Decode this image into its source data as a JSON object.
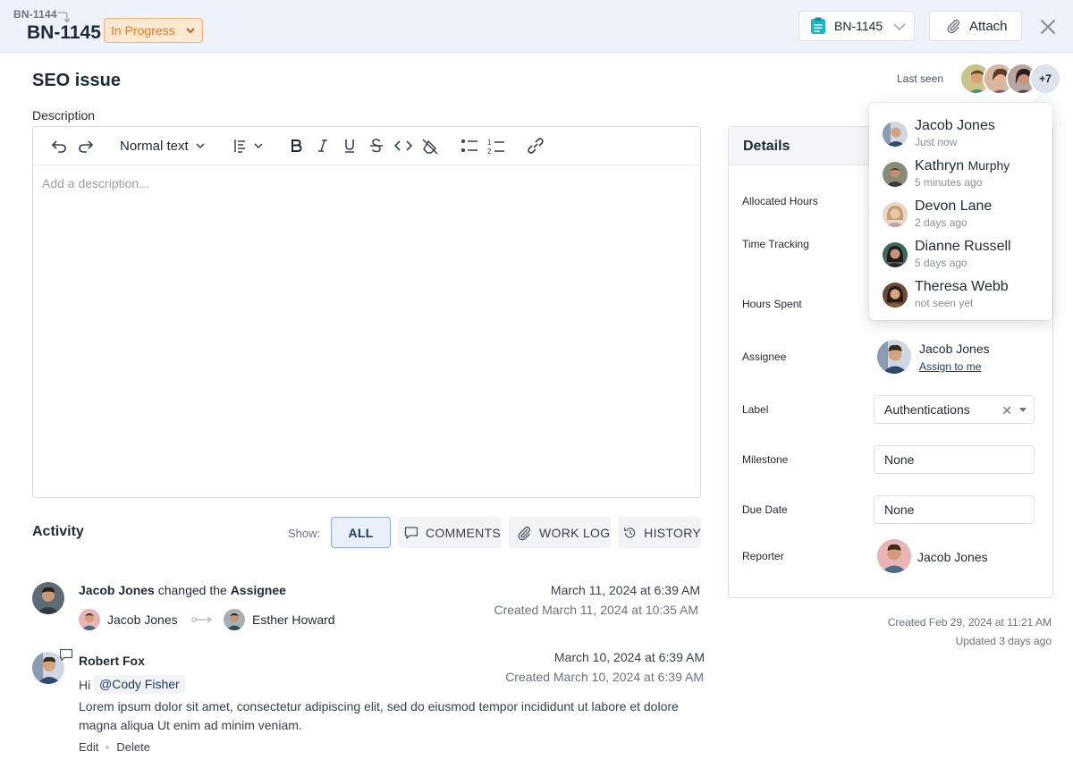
{
  "header": {
    "parent_key": "BN-1144",
    "issue_key": "BN-1145",
    "status": "In Progress",
    "key_button": "BN-1145",
    "attach_label": "Attach"
  },
  "issue": {
    "title": "SEO issue",
    "last_seen_label": "Last seen",
    "viewers_more": "+7"
  },
  "description": {
    "label": "Description",
    "text_style": "Normal text",
    "placeholder": "Add a description..."
  },
  "activity": {
    "title": "Activity",
    "show_label": "Show:",
    "filters": [
      "ALL",
      "COMMENTS",
      "WORK LOG",
      "HISTORY"
    ],
    "entries": [
      {
        "actor": "Jacob Jones",
        "action": " changed the ",
        "field": "Assignee",
        "date": "March 11, 2024 at 6:39 AM",
        "created": "Created March 11, 2024 at 10:35 AM",
        "from": "Jacob Jones",
        "to": "Esther Howard"
      },
      {
        "actor": "Robert Fox",
        "date": "March 10, 2024 at 6:39 AM",
        "created": "Created March 10, 2024 at 6:39 AM",
        "greeting": "Hi",
        "mention": "@Cody Fisher",
        "body": "Lorem ipsum dolor sit amet, consectetur adipiscing elit, sed do eiusmod tempor incididunt ut labore et dolore magna aliqua Ut enim ad minim veniam.",
        "edit_label": "Edit",
        "delete_label": "Delete"
      }
    ]
  },
  "details": {
    "title": "Details",
    "fields": {
      "allocated_hours": "Allocated Hours",
      "time_tracking": "Time Tracking",
      "hours_spent": "Hours Spent",
      "assignee": "Assignee",
      "label": "Label",
      "milestone": "Milestone",
      "due_date": "Due Date",
      "reporter": "Reporter"
    },
    "assignee_name": "Jacob Jones",
    "assign_to_me": "Assign to me",
    "label_value": "Authentications",
    "milestone_value": "None",
    "due_date_value": "None",
    "reporter_name": "Jacob Jones",
    "created": "Created Feb 29, 2024 at 11:21 AM",
    "updated": "Updated 3 days ago"
  },
  "last_seen_popup": [
    {
      "first": "Jacob Jones",
      "rest": "",
      "time": "Just now"
    },
    {
      "first": "Kathryn ",
      "rest": "Murphy",
      "time": "5 minutes ago"
    },
    {
      "first": "Devon Lane",
      "rest": "",
      "time": "2 days ago"
    },
    {
      "first": "Dianne Russell",
      "rest": "",
      "time": "5 days ago"
    },
    {
      "first": "Theresa Webb",
      "rest": "",
      "time": "not seen yet"
    }
  ],
  "colors": {
    "status_text": "#ea7a23",
    "status_bg": "#fde8d2",
    "header_bg": "#eef2fa",
    "accent": "#1f3b66",
    "clipboard_icon": "#19b6c9"
  }
}
